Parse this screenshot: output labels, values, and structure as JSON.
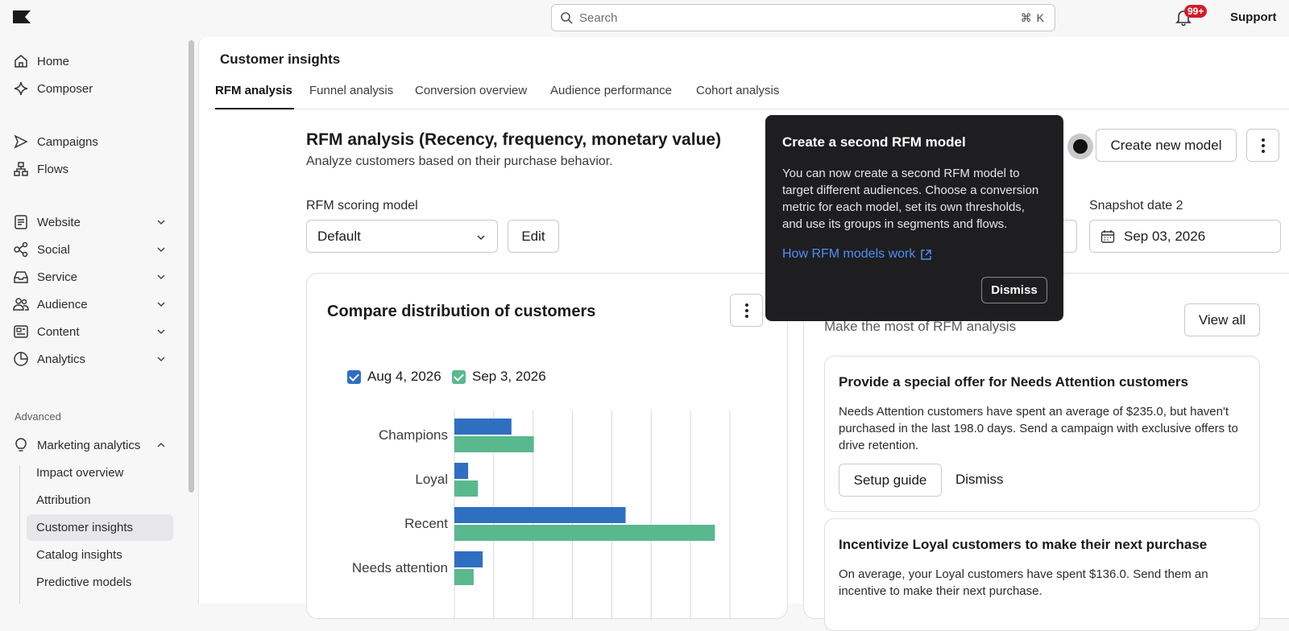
{
  "topbar": {
    "search_placeholder": "Search",
    "search_shortcut": "⌘ K",
    "notifications_badge": "99+",
    "support_label": "Support"
  },
  "sidebar": {
    "top_items": [
      {
        "label": "Home",
        "icon": "home-icon"
      },
      {
        "label": "Composer",
        "icon": "sparkle-icon"
      }
    ],
    "mid_items": [
      {
        "label": "Campaigns",
        "icon": "send-icon"
      },
      {
        "label": "Flows",
        "icon": "flow-icon"
      }
    ],
    "groups": [
      {
        "label": "Website",
        "icon": "document-icon"
      },
      {
        "label": "Social",
        "icon": "share-icon"
      },
      {
        "label": "Service",
        "icon": "inbox-icon"
      },
      {
        "label": "Audience",
        "icon": "users-icon"
      },
      {
        "label": "Content",
        "icon": "content-icon"
      },
      {
        "label": "Analytics",
        "icon": "pie-chart-icon"
      }
    ],
    "advanced_label": "Advanced",
    "marketing_analytics": {
      "label": "Marketing analytics",
      "icon": "lightbulb-icon"
    },
    "sub_items": [
      "Impact overview",
      "Attribution",
      "Customer insights",
      "Catalog insights",
      "Predictive models"
    ],
    "active_sub_item": "Customer insights"
  },
  "header": {
    "title": "Customer insights",
    "tabs": [
      "RFM analysis",
      "Funnel analysis",
      "Conversion overview",
      "Audience performance",
      "Cohort analysis"
    ],
    "active_tab": "RFM analysis"
  },
  "rfm": {
    "heading": "RFM analysis (Recency, frequency, monetary value)",
    "subheading": "Analyze customers based on their purchase behavior.",
    "scoring_model_label": "RFM scoring model",
    "scoring_model_value": "Default",
    "edit_label": "Edit",
    "create_model_label": "Create new model",
    "snapshot2_label": "Snapshot date 2",
    "snapshot2_value": "Sep 03, 2026"
  },
  "distribution_card": {
    "title": "Compare distribution of customers",
    "legend": [
      {
        "label": "Aug 4, 2026",
        "color": "#2f6fc1"
      },
      {
        "label": "Sep 3, 2026",
        "color": "#5ab88e"
      }
    ]
  },
  "chart_data": {
    "type": "bar",
    "orientation": "horizontal",
    "categories": [
      "Champions",
      "Loyal",
      "Recent",
      "Needs attention"
    ],
    "series": [
      {
        "name": "Aug 4, 2026",
        "values": [
          14.5,
          3.5,
          43.5,
          7.2
        ]
      },
      {
        "name": "Sep 3, 2026",
        "values": [
          20.2,
          6,
          66.2,
          4.9
        ]
      }
    ],
    "colors": [
      "#2f6fc1",
      "#5ab88e"
    ],
    "xlim": [
      0,
      70
    ],
    "gridlines": 7
  },
  "recommendations": {
    "subtitle": "Make the most of RFM analysis",
    "view_all_label": "View all",
    "items": [
      {
        "title": "Provide a special offer for Needs Attention customers",
        "body": "Needs Attention customers have spent an average of $235.0, but haven't purchased in the last 198.0 days. Send a campaign with exclusive offers to drive retention.",
        "primary_label": "Setup guide",
        "secondary_label": "Dismiss"
      },
      {
        "title": "Incentivize Loyal customers to make their next purchase",
        "body": "On average, your Loyal customers have spent $136.0. Send them an incentive to make their next purchase."
      }
    ]
  },
  "popover": {
    "title": "Create a second RFM model",
    "body": "You can now create a second RFM model to target different audiences. Choose a conversion metric for each model, set its own thresholds, and use its groups in segments and flows.",
    "link_label": "How RFM models work",
    "dismiss_label": "Dismiss"
  }
}
